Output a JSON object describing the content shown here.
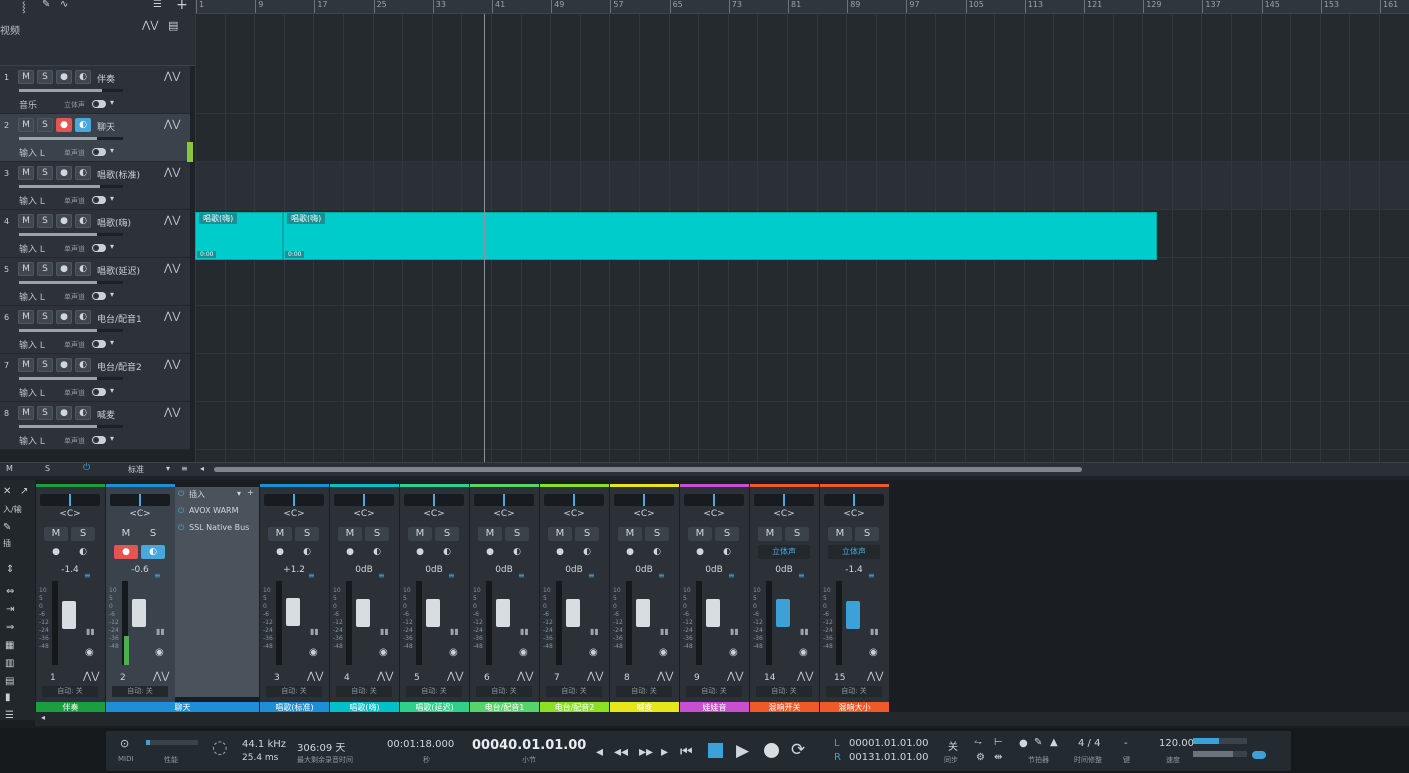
{
  "ruler": {
    "marks": [
      "1",
      "9",
      "17",
      "25",
      "33",
      "41",
      "49",
      "57",
      "65",
      "73",
      "81",
      "89",
      "97",
      "105",
      "113",
      "121",
      "129",
      "137",
      "145",
      "153",
      "161"
    ]
  },
  "video": {
    "label": "视频"
  },
  "tracks": [
    {
      "num": "1",
      "name": "伴奏",
      "input": "音乐",
      "mode": "立体声",
      "vol": 0.8,
      "selected": false,
      "rec": false,
      "mon": false
    },
    {
      "num": "2",
      "name": "聊天",
      "input": "输入 L",
      "mode": "单声道",
      "vol": 0.75,
      "selected": true,
      "rec": true,
      "mon": true
    },
    {
      "num": "3",
      "name": "唱歌(标准)",
      "input": "输入 L",
      "mode": "单声道",
      "vol": 0.78,
      "selected": false,
      "rec": false,
      "mon": false
    },
    {
      "num": "4",
      "name": "唱歌(嗨)",
      "input": "输入 L",
      "mode": "单声道",
      "vol": 0.75,
      "selected": false,
      "rec": false,
      "mon": false
    },
    {
      "num": "5",
      "name": "唱歌(延迟)",
      "input": "输入 L",
      "mode": "单声道",
      "vol": 0.75,
      "selected": false,
      "rec": false,
      "mon": false
    },
    {
      "num": "6",
      "name": "电台/配音1",
      "input": "输入 L",
      "mode": "单声道",
      "vol": 0.75,
      "selected": false,
      "rec": false,
      "mon": false
    },
    {
      "num": "7",
      "name": "电台/配音2",
      "input": "输入 L",
      "mode": "单声道",
      "vol": 0.75,
      "selected": false,
      "rec": false,
      "mon": false
    },
    {
      "num": "8",
      "name": "喊麦",
      "input": "输入 L",
      "mode": "单声道",
      "vol": 0.75,
      "selected": false,
      "rec": false,
      "mon": false
    }
  ],
  "track_buttons": {
    "mute": "M",
    "solo": "S"
  },
  "clips": [
    {
      "title": "唱歌(嗨)",
      "tail": "0:00"
    },
    {
      "title": "唱歌(嗨)",
      "tail": "0:00"
    }
  ],
  "footer": {
    "m": "M",
    "s": "S",
    "view": "标准"
  },
  "mixer": {
    "pan_label": "<C>",
    "auto_label": "自动: 关",
    "stereo_label": "立体声",
    "scale": [
      "10",
      "5",
      "0",
      "-6",
      "-12",
      "-24",
      "-36",
      "-48"
    ],
    "inserts": {
      "header": "插入",
      "items": [
        "AVOX WARM",
        "SSL Native Bus"
      ]
    },
    "strips": [
      {
        "num": "1",
        "vol": "-1.4",
        "name": "伴奏",
        "color": "#1b9e3e",
        "fader": 0.65,
        "meter": 0.0
      },
      {
        "num": "2",
        "vol": "-0.6",
        "name": "聊天",
        "color": "#1e8fd6",
        "fader": 0.67,
        "meter": 0.35
      },
      {
        "num": "3",
        "vol": "+1.2",
        "name": "唱歌(标准)",
        "color": "#1e8fd6",
        "fader": 0.7,
        "meter": 0.0
      },
      {
        "num": "4",
        "vol": "0dB",
        "name": "唱歌(嗨)",
        "color": "#00c0c8",
        "fader": 0.68,
        "meter": 0.0
      },
      {
        "num": "5",
        "vol": "0dB",
        "name": "唱歌(延迟)",
        "color": "#2fd08a",
        "fader": 0.68,
        "meter": 0.0
      },
      {
        "num": "6",
        "vol": "0dB",
        "name": "电台/配音1",
        "color": "#54d46a",
        "fader": 0.68,
        "meter": 0.0
      },
      {
        "num": "7",
        "vol": "0dB",
        "name": "电台/配音2",
        "color": "#8be024",
        "fader": 0.68,
        "meter": 0.0
      },
      {
        "num": "8",
        "vol": "0dB",
        "name": "喊麦",
        "color": "#e6e61a",
        "fader": 0.68,
        "meter": 0.0
      },
      {
        "num": "9",
        "vol": "0dB",
        "name": "娃娃音",
        "color": "#c84fcf",
        "fader": 0.68,
        "meter": 0.0
      },
      {
        "num": "14",
        "vol": "0dB",
        "name": "混响开关",
        "color": "#f05a28",
        "fader": 0.68,
        "meter": 0.0
      },
      {
        "num": "15",
        "vol": "-1.4",
        "name": "混响大小",
        "color": "#f05a28",
        "fader": 0.65,
        "meter": 0.0
      }
    ]
  },
  "transport": {
    "midi": "MIDI",
    "perf": "性能",
    "sample_rate": "44.1 kHz",
    "latency": "25.4 ms",
    "record_time": "306:09 天",
    "record_label": "最大剩余录音时间",
    "position_time": "00:01:18.000",
    "time_unit": "秒",
    "position_bars": "00040.01.01.00",
    "bars_unit": "小节",
    "loop_l": "00001.01.01.00",
    "loop_r": "00131.01.01.00",
    "L": "L",
    "R": "R",
    "sync_value": "关",
    "sync_label": "同步",
    "metronome_label": "节拍器",
    "time_sig": "4 / 4",
    "time_sig_label": "时间修整",
    "key_value": "-",
    "key_label": "键",
    "tempo": "120.00",
    "tempo_label": "速度"
  }
}
